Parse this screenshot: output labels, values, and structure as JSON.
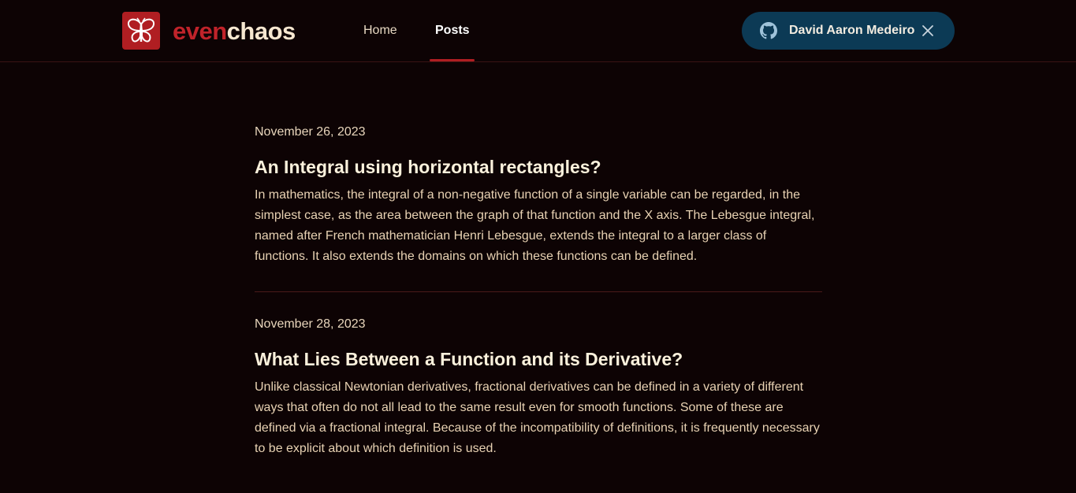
{
  "brand": {
    "part1": "even",
    "part2": "chaos",
    "logo_icon": "butterfly-icon"
  },
  "nav": {
    "items": [
      {
        "label": "Home"
      },
      {
        "label": "Posts",
        "active": true
      }
    ]
  },
  "user": {
    "name": "David Aaron Medeiro",
    "icon": "github-icon"
  },
  "posts": [
    {
      "date": "November 26, 2023",
      "title": "An Integral using horizontal rectangles?",
      "excerpt": "In mathematics, the integral of a non-negative function of a single variable can be regarded, in the simplest case, as the area between the graph of that function and the X axis. The Lebesgue integral, named after French mathematician Henri Lebesgue, extends the integral to a larger class of functions. It also extends the domains on which these functions can be defined."
    },
    {
      "date": "November 28, 2023",
      "title": "What Lies Between a Function and its Derivative?",
      "excerpt": "Unlike classical Newtonian derivatives, fractional derivatives can be defined in a variety of different ways that often do not all lead to the same result even for smooth functions. Some of these are defined via a fractional integral. Because of the incompatibility of definitions, it is frequently necessary to be explicit about which definition is used."
    }
  ],
  "colors": {
    "background": "#0d0304",
    "accent": "#b01e22",
    "pill": "#0c3a55"
  }
}
